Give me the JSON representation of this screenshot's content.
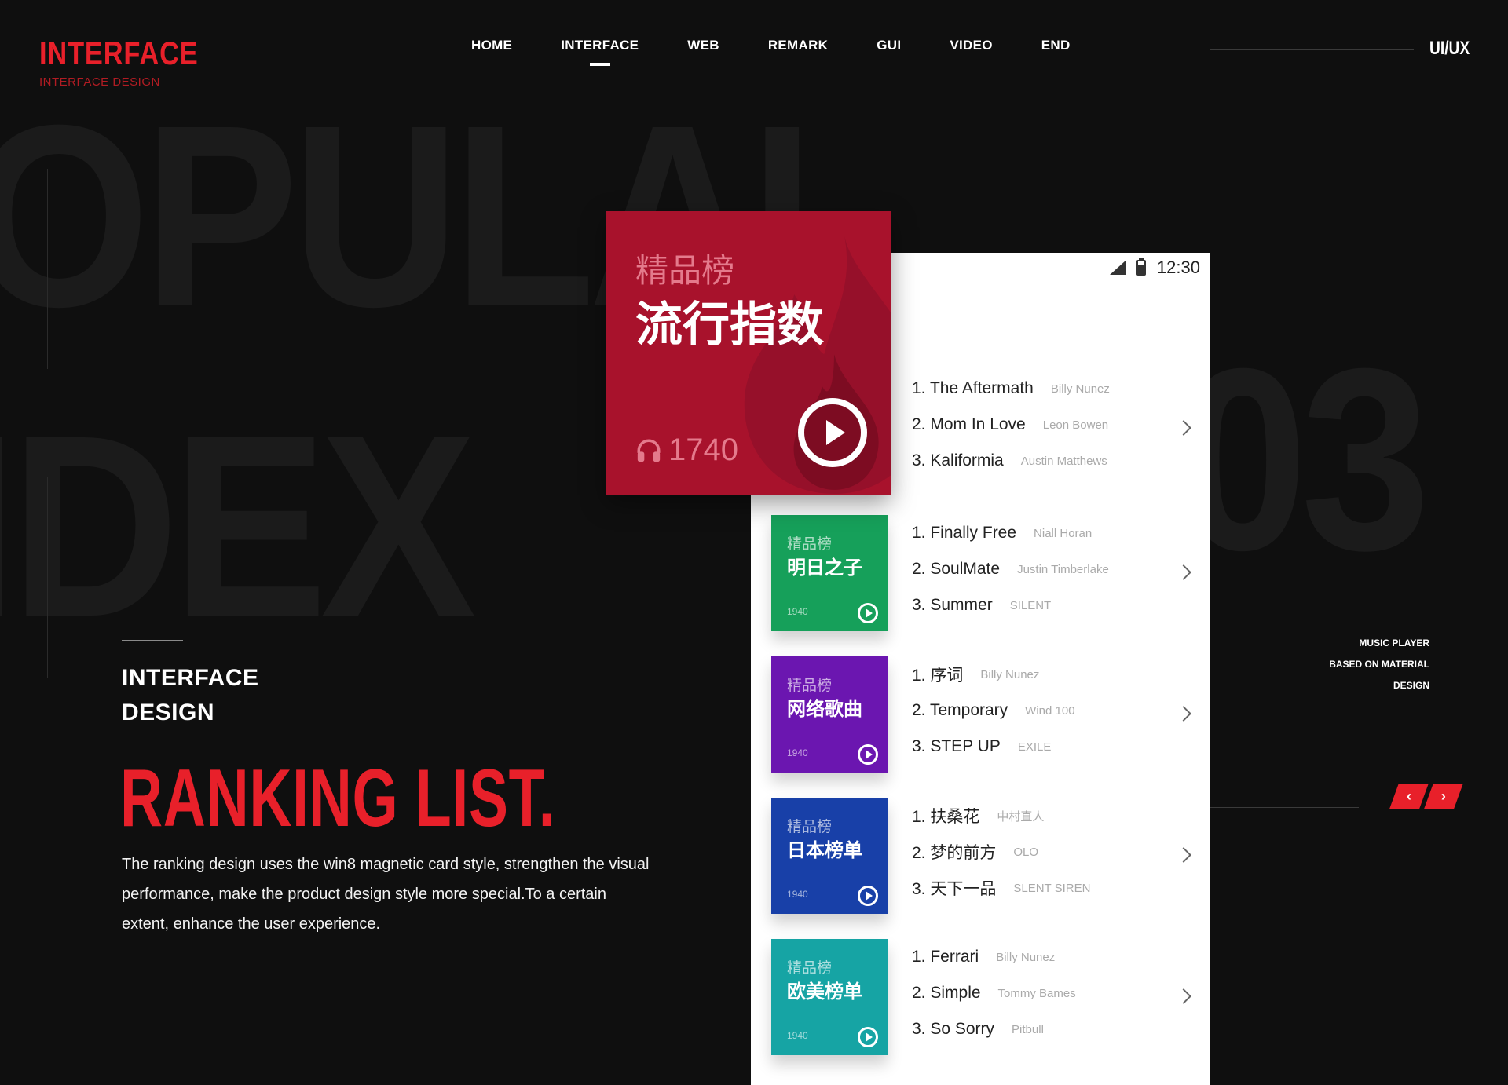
{
  "background": {
    "word_top": "OPULAI",
    "word_bottom": "IDEX",
    "number": "03"
  },
  "header": {
    "logo_main": "INTERFACE",
    "logo_sub": "INTERFACE DESIGN",
    "nav": [
      {
        "label": "HOME"
      },
      {
        "label": "INTERFACE",
        "active": true
      },
      {
        "label": "WEB"
      },
      {
        "label": "REMARK"
      },
      {
        "label": "GUI"
      },
      {
        "label": "VIDEO"
      },
      {
        "label": "END"
      }
    ],
    "badge": "UI/UX"
  },
  "intro": {
    "subtitle_line1": "INTERFACE",
    "subtitle_line2": "DESIGN",
    "title": "RANKING LIST.",
    "description": "The ranking design uses the win8 magnetic card style, strengthen the visual performance, make the product design style more special.To a certain extent, enhance the user experience."
  },
  "side_info": {
    "line1": "MUSIC PLAYER",
    "line2": "BASED ON MATERIAL",
    "line3": "DESIGN"
  },
  "pager": {
    "prev": "‹",
    "next": "›"
  },
  "colors": {
    "accent": "#e8202a",
    "featured": "#a8122c",
    "green": "#16a05a",
    "purple": "#6b16b0",
    "blue": "#1840a8",
    "teal": "#16a4a4"
  },
  "phone": {
    "time": "12:30",
    "featured": {
      "category": "精品榜",
      "title": "流行指数",
      "count": "1740"
    },
    "lists": [
      {
        "songs": [
          {
            "title": "1. The Aftermath",
            "artist": "Billy Nunez"
          },
          {
            "title": "2. Mom In Love",
            "artist": "Leon Bowen"
          },
          {
            "title": "3. Kaliformia",
            "artist": "Austin Matthews"
          }
        ]
      },
      {
        "card": {
          "category": "精品榜",
          "title": "明日之子",
          "count": "1940",
          "color": "#16a05a"
        },
        "songs": [
          {
            "title": "1. Finally Free",
            "artist": "Niall Horan"
          },
          {
            "title": "2. SoulMate",
            "artist": "Justin Timberlake"
          },
          {
            "title": "3. Summer",
            "artist": "SILENT"
          }
        ]
      },
      {
        "card": {
          "category": "精品榜",
          "title": "网络歌曲",
          "count": "1940",
          "color": "#6b16b0"
        },
        "songs": [
          {
            "title": "1. 序词",
            "artist": "Billy Nunez"
          },
          {
            "title": "2. Temporary",
            "artist": "Wind 100"
          },
          {
            "title": "3. STEP UP",
            "artist": "EXILE"
          }
        ]
      },
      {
        "card": {
          "category": "精品榜",
          "title": "日本榜单",
          "count": "1940",
          "color": "#1840a8"
        },
        "songs": [
          {
            "title": "1. 扶桑花",
            "artist": "中村直人"
          },
          {
            "title": "2. 梦的前方",
            "artist": "OLO"
          },
          {
            "title": "3. 天下一品",
            "artist": "SLENT SIREN"
          }
        ]
      },
      {
        "card": {
          "category": "精品榜",
          "title": "欧美榜单",
          "count": "1940",
          "color": "#16a4a4"
        },
        "songs": [
          {
            "title": "1. Ferrari",
            "artist": "Billy Nunez"
          },
          {
            "title": "2. Simple",
            "artist": "Tommy Bames"
          },
          {
            "title": "3. So Sorry",
            "artist": "Pitbull"
          }
        ]
      }
    ]
  }
}
